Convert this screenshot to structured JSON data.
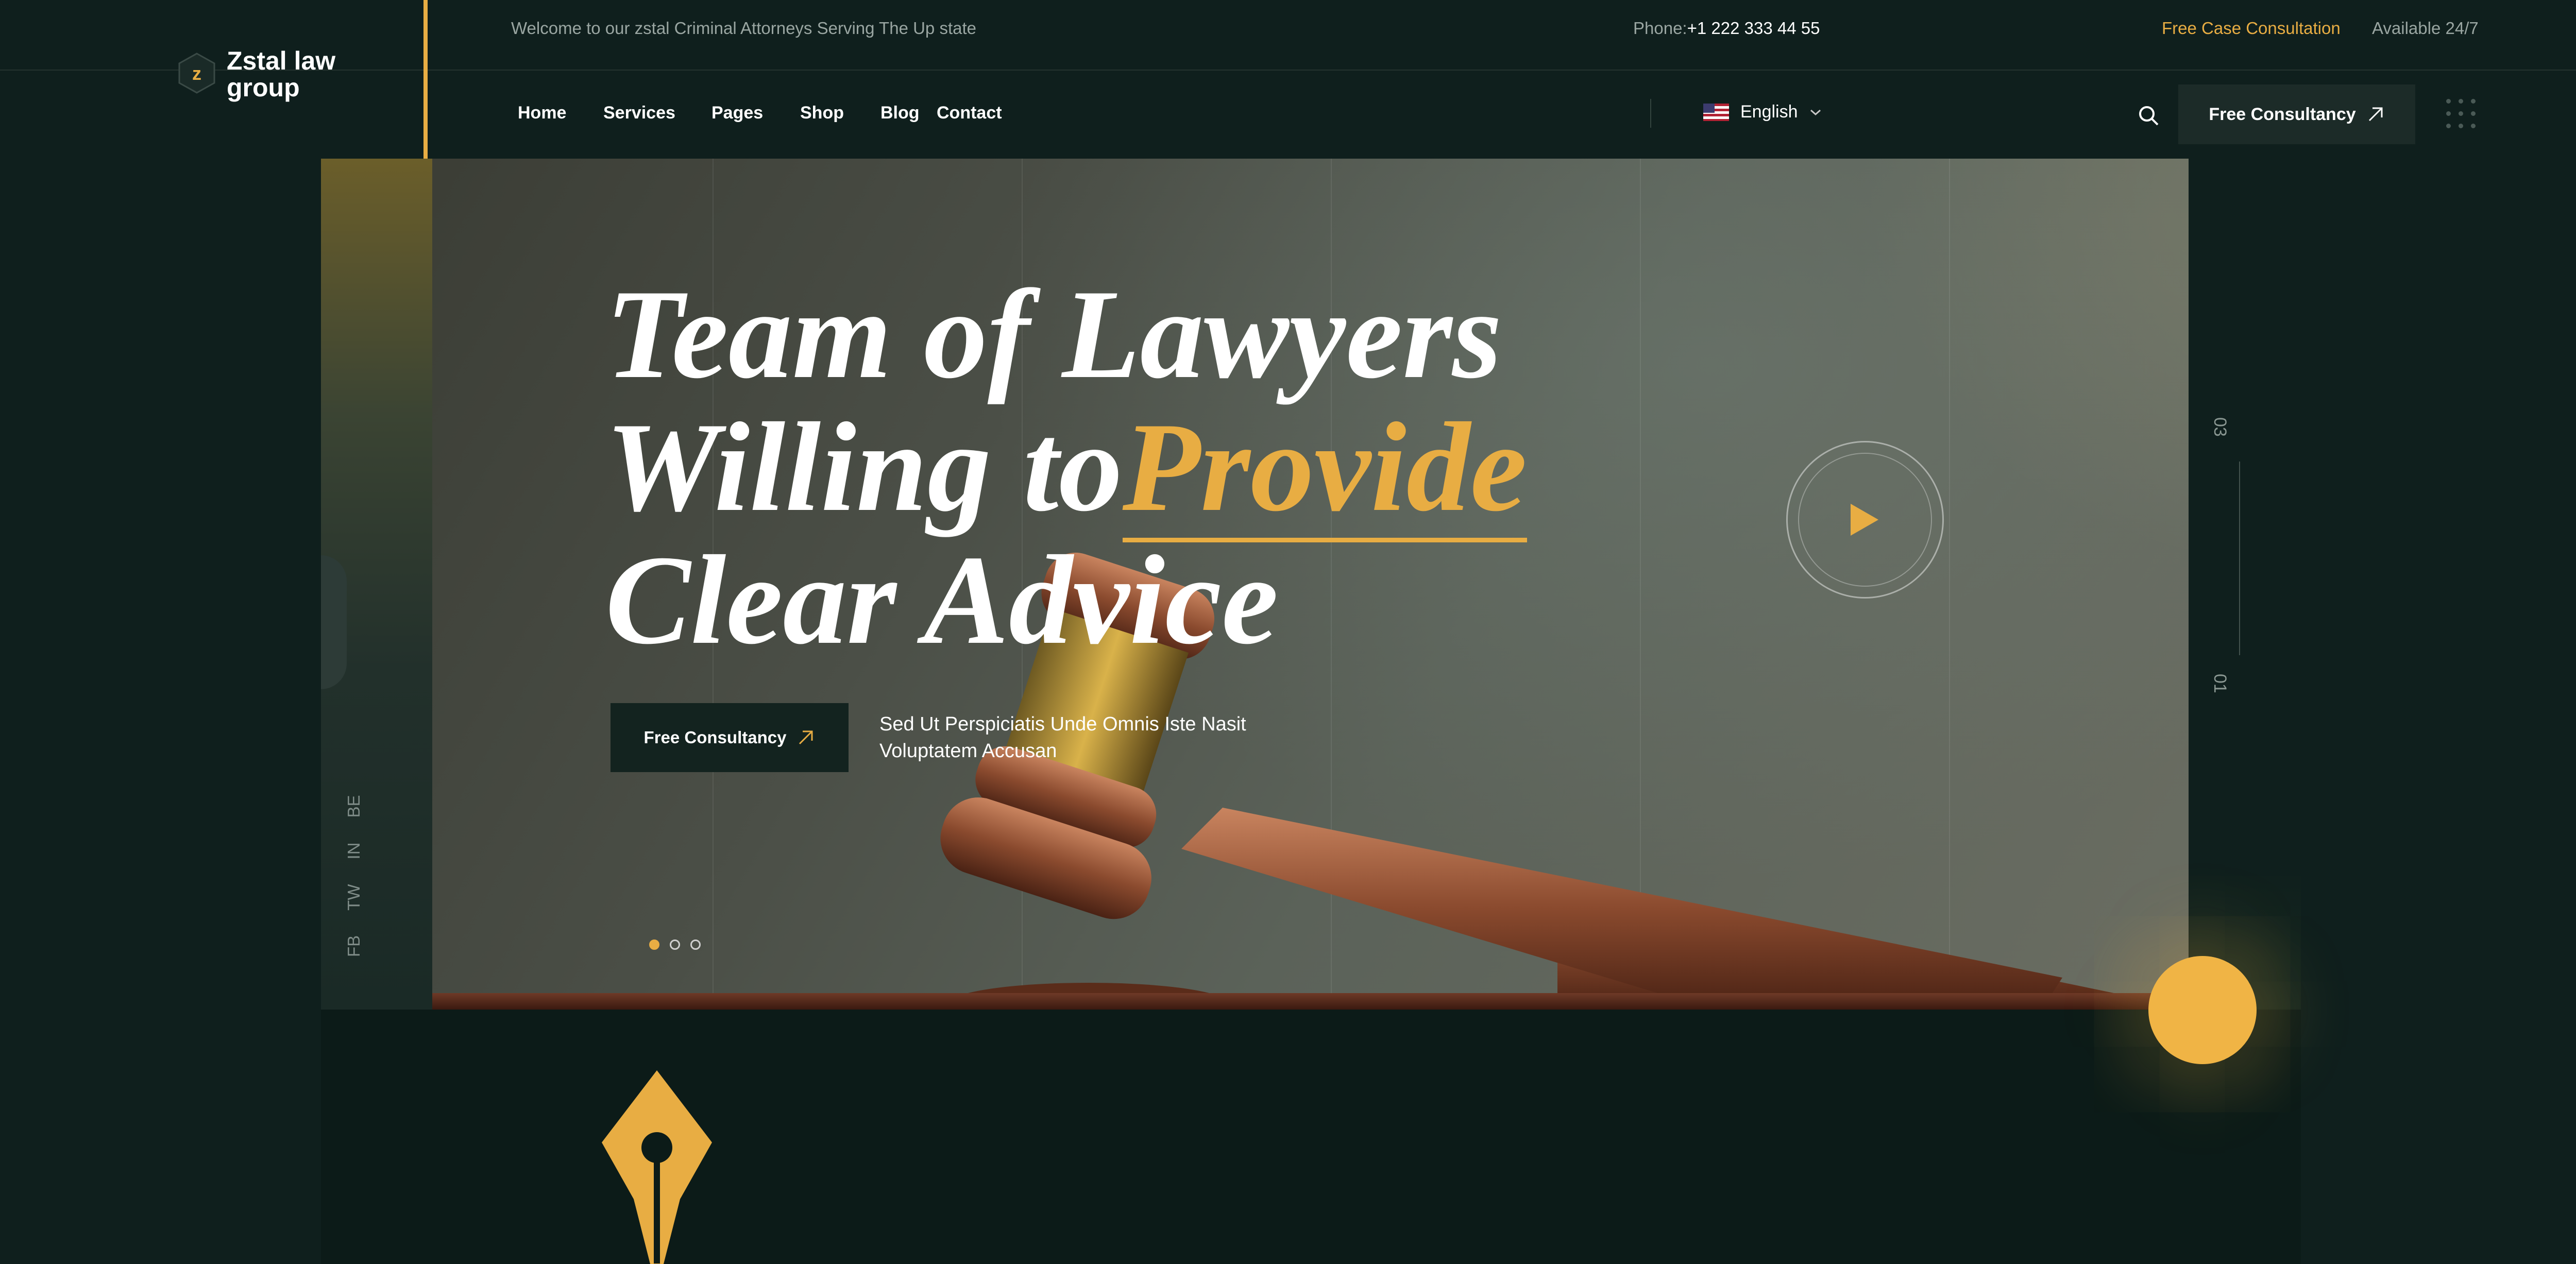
{
  "topbar": {
    "welcome": "Welcome to our zstal Criminal Attorneys Serving The Up state",
    "phone_label": "Phone:",
    "phone_number": "+1 222 333 44 55",
    "free_case": "Free Case Consultation",
    "available": "Available 24/7"
  },
  "logo": {
    "badge_letter": "z",
    "name": "Zstal law\ngroup"
  },
  "nav": {
    "items": [
      "Home",
      "Services",
      "Pages",
      "Shop",
      "Blog",
      "Contact"
    ],
    "language": "English",
    "cta": "Free Consultancy"
  },
  "hero": {
    "line1": "Team of Lawyers",
    "line2": "Willing to",
    "line2_highlight": "Provide",
    "line3": "Clear Advice",
    "cta": "Free Consultancy",
    "description": "Sed Ut Perspiciatis Unde Omnis Iste Nasit Voluptatem Accusan",
    "slide_current": "01",
    "slide_total": "03"
  },
  "socials": [
    "FB",
    "TW",
    "IN",
    "BE"
  ],
  "colors": {
    "accent": "#e8ad43",
    "background": "#0f1f1d",
    "button": "#1c2b28"
  }
}
